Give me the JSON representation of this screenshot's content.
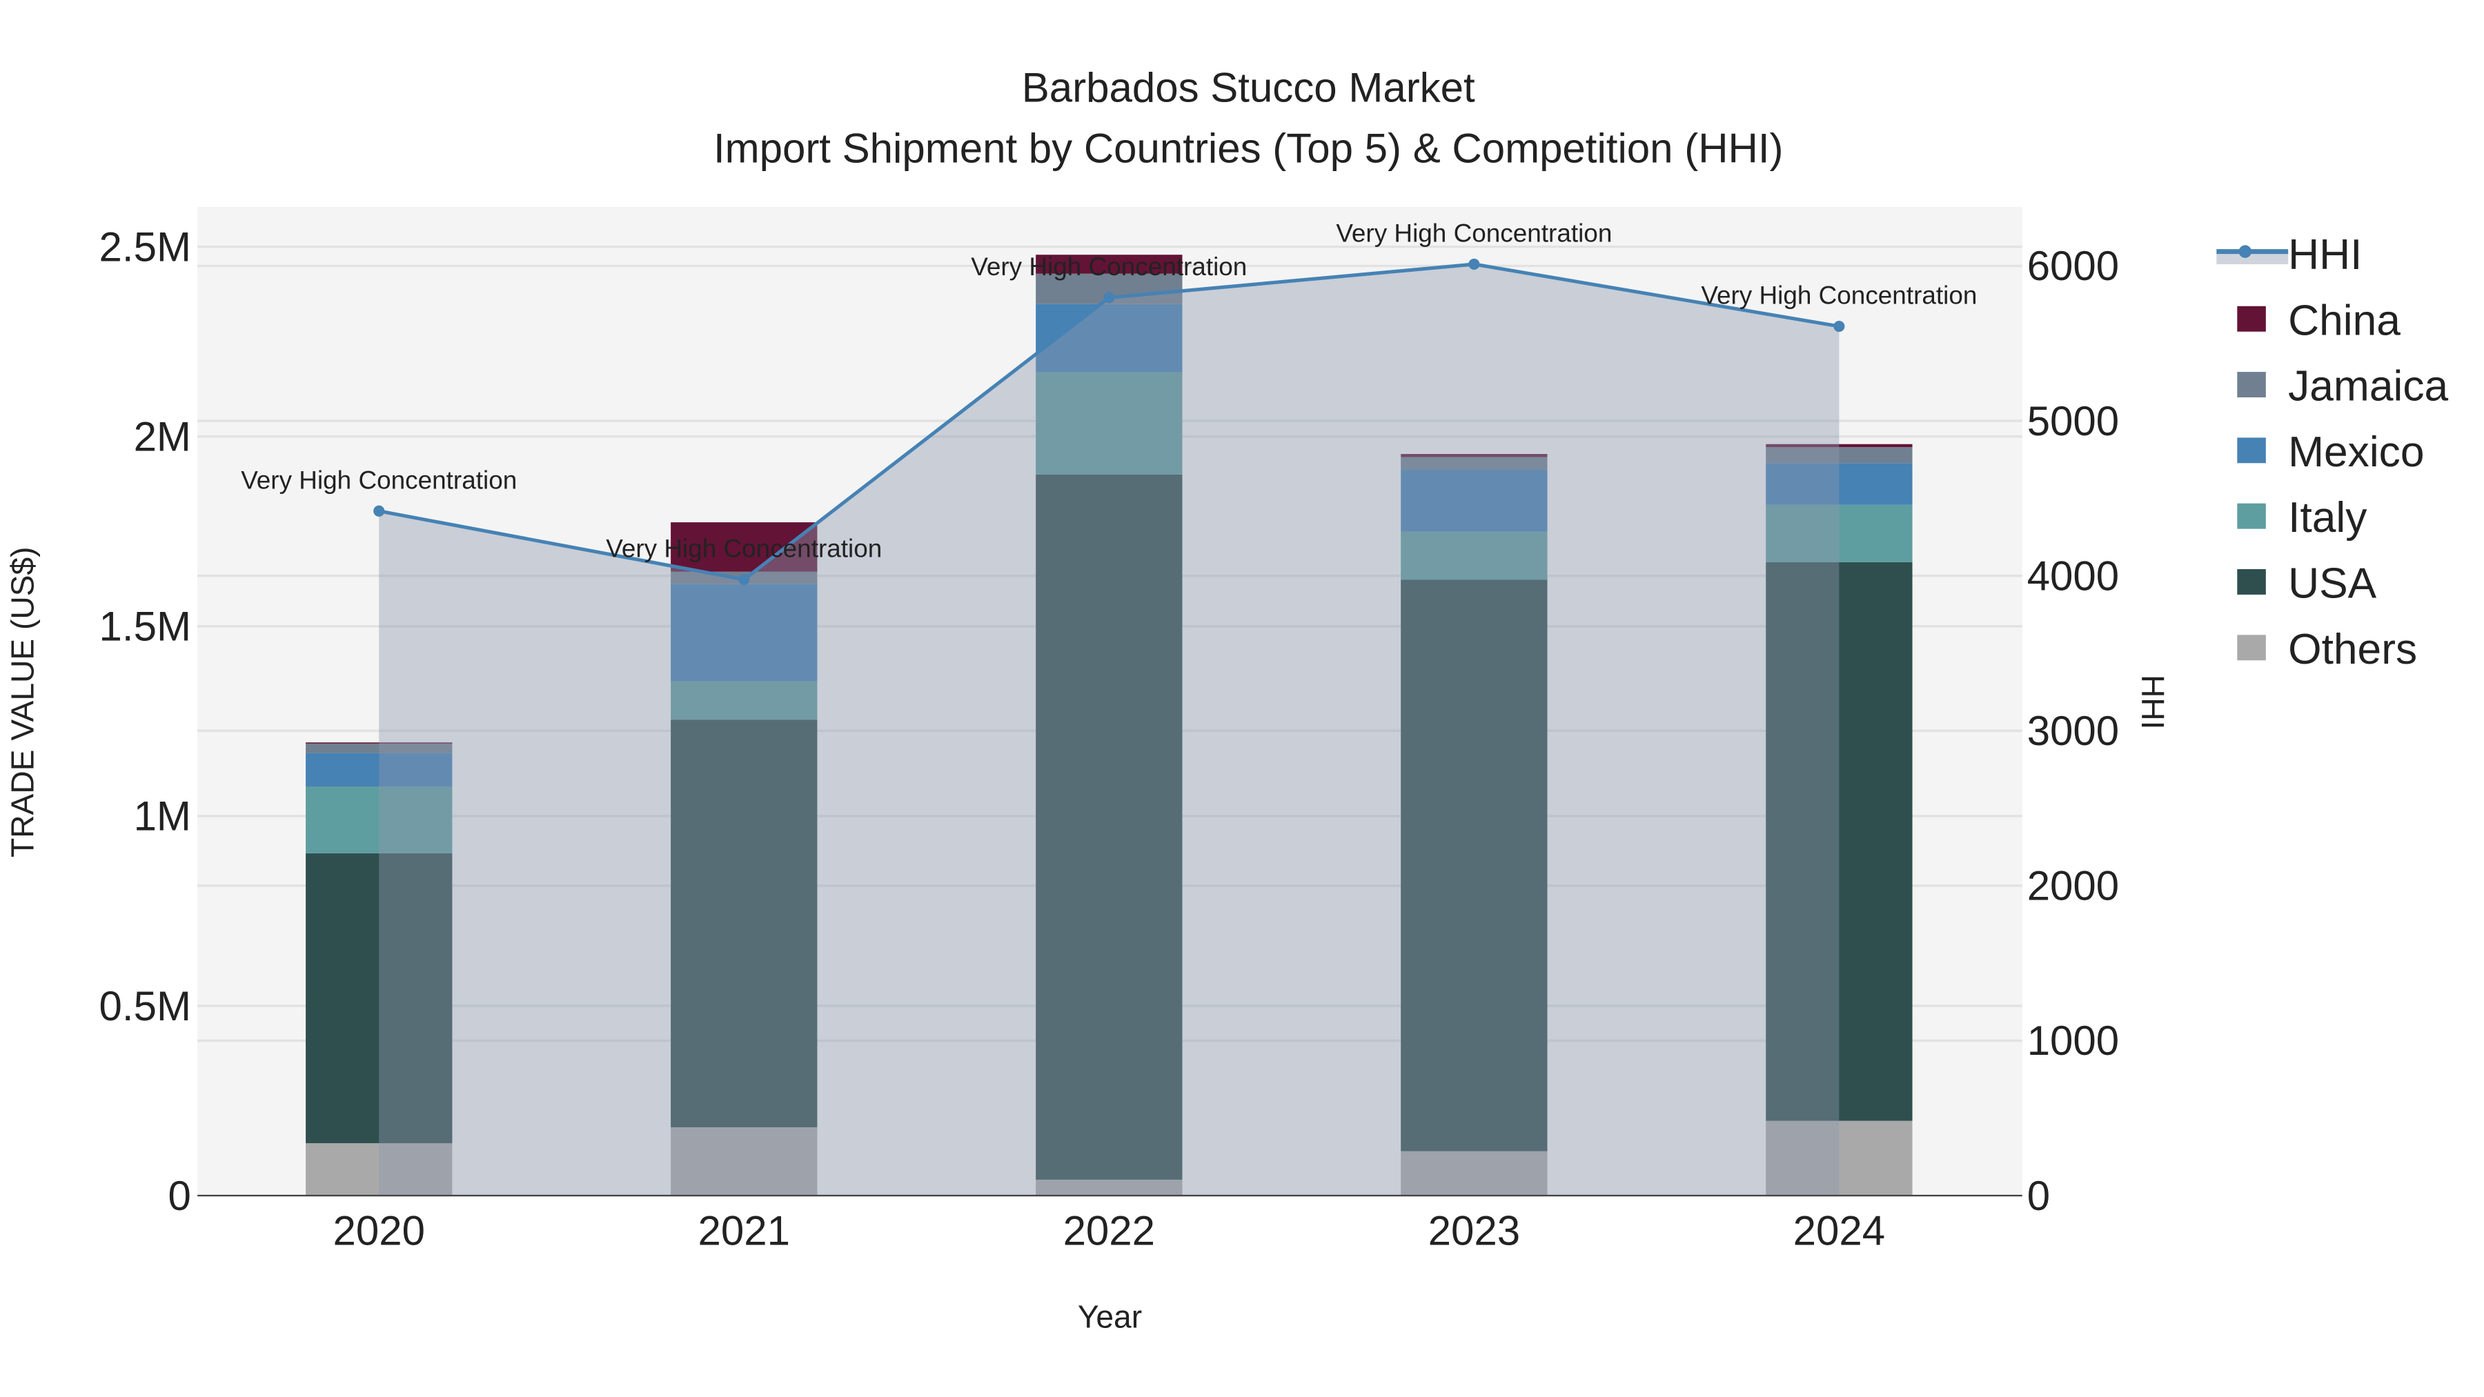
{
  "chart_data": {
    "type": "bar",
    "title": "Barbados Stucco Market",
    "subtitle": "Import Shipment by Countries (Top 5) & Competition (HHI)",
    "xlabel": "Year",
    "ylabel": "TRADE VALUE (US$)",
    "y2label": "HHI",
    "categories": [
      "2020",
      "2021",
      "2022",
      "2023",
      "2024"
    ],
    "ylim": [
      0,
      2600000
    ],
    "y2lim": [
      0,
      6400
    ],
    "yticks": [
      {
        "v": 0,
        "label": "0"
      },
      {
        "v": 500000,
        "label": "0.5M"
      },
      {
        "v": 1000000,
        "label": "1M"
      },
      {
        "v": 1500000,
        "label": "1.5M"
      },
      {
        "v": 2000000,
        "label": "2M"
      },
      {
        "v": 2500000,
        "label": "2.5M"
      }
    ],
    "y2ticks": [
      {
        "v": 0,
        "label": "0"
      },
      {
        "v": 1000,
        "label": "1000"
      },
      {
        "v": 2000,
        "label": "2000"
      },
      {
        "v": 3000,
        "label": "3000"
      },
      {
        "v": 4000,
        "label": "4000"
      },
      {
        "v": 5000,
        "label": "5000"
      },
      {
        "v": 6000,
        "label": "6000"
      }
    ],
    "grid": true,
    "legend_position": "right",
    "stacked": true,
    "series": [
      {
        "name": "Others",
        "color": "#a9a9a9",
        "values": [
          138000,
          180000,
          42000,
          117000,
          197000
        ]
      },
      {
        "name": "USA",
        "color": "#2f4f4f",
        "values": [
          764000,
          1074000,
          1858000,
          1506000,
          1472000
        ]
      },
      {
        "name": "Italy",
        "color": "#5f9ea0",
        "values": [
          176000,
          101000,
          269000,
          126000,
          151000
        ]
      },
      {
        "name": "Mexico",
        "color": "#4682b4",
        "values": [
          88000,
          256000,
          180000,
          164000,
          110000
        ]
      },
      {
        "name": "Jamaica",
        "color": "#708090",
        "values": [
          25000,
          33000,
          80000,
          33000,
          42000
        ]
      },
      {
        "name": "China",
        "color": "#631336",
        "values": [
          3000,
          130000,
          50000,
          8000,
          8000
        ]
      }
    ],
    "hhi": {
      "name": "HHI",
      "color": "#4682b4",
      "values": [
        4418,
        3976,
        5795,
        6011,
        5610
      ],
      "annotations": [
        "Very High Concentration",
        "Very High Concentration",
        "Very High Concentration",
        "Very High Concentration",
        "Very High Concentration"
      ]
    },
    "legend_order": [
      "HHI",
      "China",
      "Jamaica",
      "Mexico",
      "Italy",
      "USA",
      "Others"
    ]
  }
}
